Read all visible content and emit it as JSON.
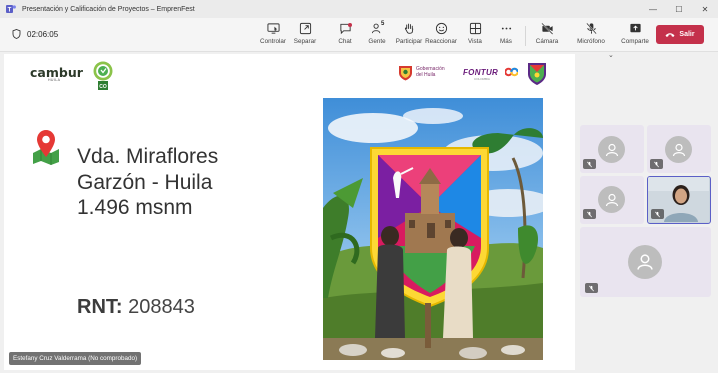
{
  "window": {
    "title": "Presentación y Calificación de Proyectos – EmprenFest"
  },
  "toolbar": {
    "timer": "02:06:05",
    "controlar": "Controlar",
    "separar": "Separar",
    "chat": "Chat",
    "gente": "Gente",
    "gente_count": "5",
    "participar": "Participar",
    "reaccionar": "Reaccionar",
    "vista": "Vista",
    "mas": "Más",
    "camara": "Cámara",
    "microfono": "Micrófono",
    "comparte": "Comparte",
    "salir": "Salir"
  },
  "slide": {
    "logo_cambur": "cambur",
    "logo_cambur_sub": "HUILA",
    "gob_line1": "Gobernación",
    "gob_line2": "del Huila",
    "fontur": "FONTUR",
    "fontur_sub": "COLOMBIA",
    "location_line1": "Vda. Miraflores",
    "location_line2": "Garzón - Huila",
    "location_line3": "1.496 msnm",
    "rnt_label": "RNT:",
    "rnt_value": "208843"
  },
  "presenter": {
    "name": "Estefany Cruz Valderrama (No comprobado)"
  },
  "colors": {
    "leave": "#c4314b",
    "tile_bg": "#e9e4ef",
    "active_border": "#5b5fc7"
  }
}
